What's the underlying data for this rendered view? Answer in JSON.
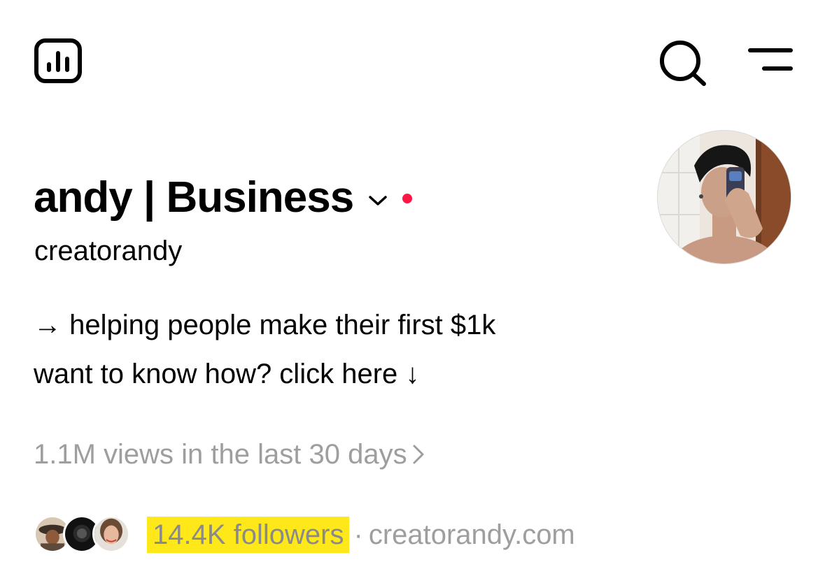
{
  "header": {
    "display_name": "andy | Business",
    "username": "creatorandy",
    "notification_color": "#ff1744"
  },
  "bio": {
    "line1": "→ helping people make their first $1k",
    "line2": "want to know how? click here ↓"
  },
  "stats": {
    "views_text": "1.1M views in the last 30 days"
  },
  "social": {
    "followers_text": "14.4K followers",
    "separator": "·",
    "link": "creatorandy.com",
    "highlight_color": "#ffe81a"
  },
  "icons": {
    "insights": "insights-icon",
    "search": "search-icon",
    "menu": "menu-icon",
    "dropdown": "chevron-down-icon"
  }
}
